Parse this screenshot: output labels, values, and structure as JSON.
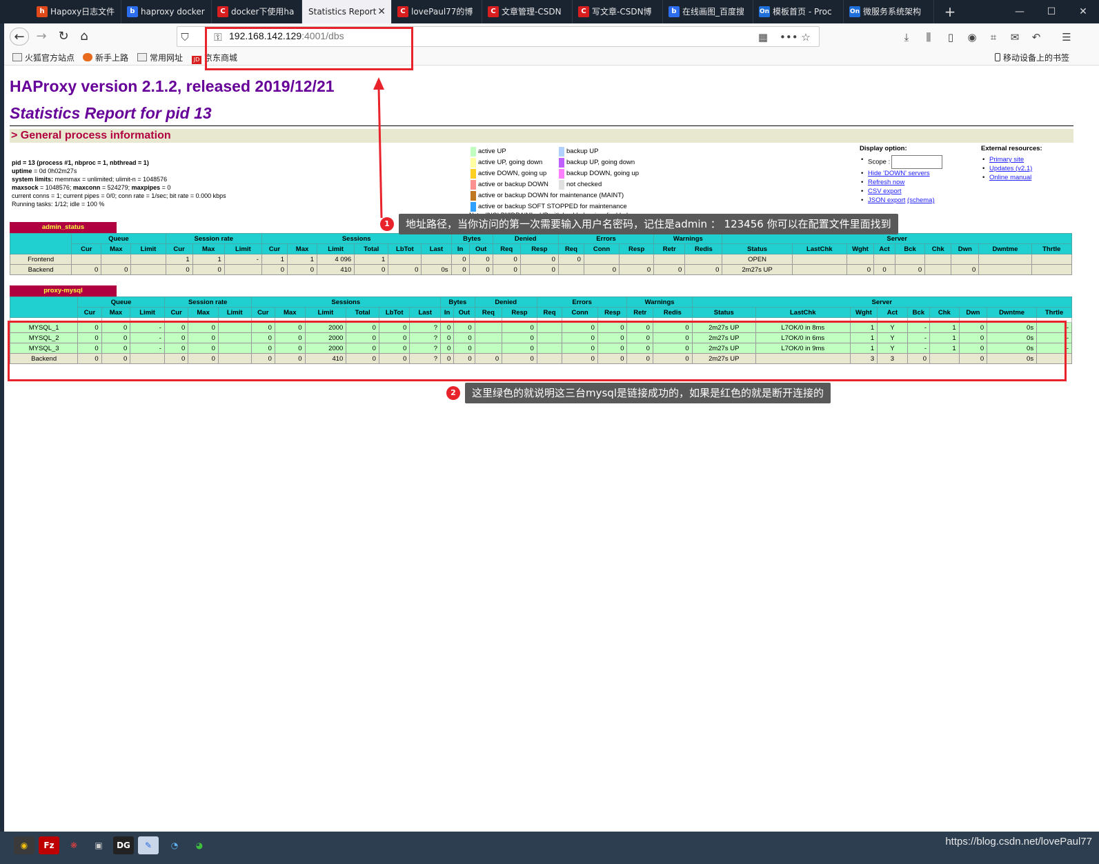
{
  "browser": {
    "tabs": [
      {
        "label": "Hapoxy日志文件",
        "icon": "h"
      },
      {
        "label": "haproxy docker",
        "icon": "b"
      },
      {
        "label": "docker下使用ha",
        "icon": "C"
      },
      {
        "label": "Statistics Report",
        "icon": ""
      },
      {
        "label": "lovePaul77的博",
        "icon": "C"
      },
      {
        "label": "文章管理-CSDN",
        "icon": "C"
      },
      {
        "label": "写文章-CSDN博",
        "icon": "C"
      },
      {
        "label": "在线画图_百度搜",
        "icon": "b"
      },
      {
        "label": "模板首页 - Proc",
        "icon": "On"
      },
      {
        "label": "微服务系统架构",
        "icon": "On"
      }
    ],
    "url_host": "192.168.142.129",
    "url_path": ":4001/dbs",
    "bookmarks": [
      "火狐官方站点",
      "新手上路",
      "常用网址",
      "京东商城"
    ],
    "mobile_bookmarks": "移动设备上的书签"
  },
  "page": {
    "h1": "HAProxy version 2.1.2, released 2019/12/21",
    "h2": "Statistics Report for pid 13",
    "section": "> General process information",
    "proc": {
      "l1": "pid = 13 (process #1, nbproc = 1, nbthread = 1)",
      "l2b": "uptime",
      "l2": " = 0d 0h02m27s",
      "l3b": "system limits:",
      "l3": " memmax = unlimited; ulimit-n = 1048576",
      "l4b": "maxsock",
      "l4": " = 1048576; ",
      "l4b2": "maxconn",
      "l4c": " = 524279; ",
      "l4b3": "maxpipes",
      "l4d": " = 0",
      "l5": "current conns = 1; current pipes = 0/0; conn rate = 1/sec; bit rate = 0.000 kbps",
      "l6": "Running tasks: 1/12; idle = 100 %"
    },
    "legend": {
      "left": [
        "active UP",
        "active UP, going down",
        "active DOWN, going up",
        "active or backup DOWN",
        "active or backup DOWN for maintenance (MAINT)",
        "active or backup SOFT STOPPED for maintenance"
      ],
      "right": [
        "backup UP",
        "backup UP, going down",
        "backup DOWN, going up",
        "not checked"
      ],
      "note": "Note: \"NOLB\"/\"DRAIN\" = UP with load-balancing disabled.",
      "colors_left": [
        "#c0ffc0",
        "#ffffa0",
        "#ffd020",
        "#ff9090",
        "#c07820",
        "#30a0ff"
      ],
      "colors_right": [
        "#b0d0ff",
        "#c060ff",
        "#ff80ff",
        "#e0e0e0"
      ]
    },
    "display": {
      "title": "Display option:",
      "scope": "Scope :",
      "links": [
        "Hide 'DOWN' servers",
        "Refresh now",
        "CSV export",
        "JSON export"
      ],
      "schema": "(schema)"
    },
    "external": {
      "title": "External resources:",
      "links": [
        "Primary site",
        "Updates (v2.1)",
        "Online manual"
      ]
    }
  },
  "tables": {
    "admin": {
      "name": "admin_status",
      "groups": [
        "Queue",
        "Session rate",
        "Sessions",
        "Bytes",
        "Denied",
        "Errors",
        "Warnings",
        "Server"
      ],
      "cols": [
        "Cur",
        "Max",
        "Limit",
        "Cur",
        "Max",
        "Limit",
        "Cur",
        "Max",
        "Limit",
        "Total",
        "LbTot",
        "Last",
        "In",
        "Out",
        "Req",
        "Resp",
        "Req",
        "Conn",
        "Resp",
        "Retr",
        "Redis",
        "Status",
        "LastChk",
        "Wght",
        "Act",
        "Bck",
        "Chk",
        "Dwn",
        "Dwntme",
        "Thrtle"
      ],
      "rows": [
        {
          "cls": "fe",
          "cells": [
            "Frontend",
            "",
            "",
            "",
            "1",
            "1",
            "-",
            "1",
            "1",
            "4 096",
            "1",
            "",
            "",
            "0",
            "0",
            "0",
            "0",
            "0",
            "",
            "",
            "",
            "",
            "OPEN",
            "",
            "",
            "",
            "",
            "",
            "",
            "",
            ""
          ]
        },
        {
          "cls": "be",
          "cells": [
            "Backend",
            "0",
            "0",
            "",
            "0",
            "0",
            "",
            "0",
            "0",
            "410",
            "0",
            "0",
            "0s",
            "0",
            "0",
            "0",
            "0",
            "",
            "0",
            "0",
            "0",
            "0",
            "2m27s UP",
            "",
            "0",
            "0",
            "0",
            "",
            "0",
            "",
            ""
          ]
        }
      ]
    },
    "mysql": {
      "name": "proxy-mysql",
      "groups": [
        "Queue",
        "Session rate",
        "Sessions",
        "Bytes",
        "Denied",
        "Errors",
        "Warnings",
        "Server"
      ],
      "cols": [
        "Cur",
        "Max",
        "Limit",
        "Cur",
        "Max",
        "Limit",
        "Cur",
        "Max",
        "Limit",
        "Total",
        "LbTot",
        "Last",
        "In",
        "Out",
        "Req",
        "Resp",
        "Req",
        "Conn",
        "Resp",
        "Retr",
        "Redis",
        "Status",
        "LastChk",
        "Wght",
        "Act",
        "Bck",
        "Chk",
        "Dwn",
        "Dwntme",
        "Thrtle"
      ],
      "rows": [
        {
          "cls": "up",
          "cells": [
            "MYSQL_1",
            "0",
            "0",
            "-",
            "0",
            "0",
            "",
            "0",
            "0",
            "2000",
            "0",
            "0",
            "?",
            "0",
            "0",
            "",
            "0",
            "",
            "0",
            "0",
            "0",
            "0",
            "2m27s UP",
            "L7OK/0 in 8ms",
            "1",
            "Y",
            "-",
            "1",
            "0",
            "0s",
            "-"
          ]
        },
        {
          "cls": "up",
          "cells": [
            "MYSQL_2",
            "0",
            "0",
            "-",
            "0",
            "0",
            "",
            "0",
            "0",
            "2000",
            "0",
            "0",
            "?",
            "0",
            "0",
            "",
            "0",
            "",
            "0",
            "0",
            "0",
            "0",
            "2m27s UP",
            "L7OK/0 in 6ms",
            "1",
            "Y",
            "-",
            "1",
            "0",
            "0s",
            "-"
          ]
        },
        {
          "cls": "up",
          "cells": [
            "MYSQL_3",
            "0",
            "0",
            "-",
            "0",
            "0",
            "",
            "0",
            "0",
            "2000",
            "0",
            "0",
            "?",
            "0",
            "0",
            "",
            "0",
            "",
            "0",
            "0",
            "0",
            "0",
            "2m27s UP",
            "L7OK/0 in 9ms",
            "1",
            "Y",
            "-",
            "1",
            "0",
            "0s",
            "-"
          ]
        },
        {
          "cls": "be",
          "cells": [
            "Backend",
            "0",
            "0",
            "",
            "0",
            "0",
            "",
            "0",
            "0",
            "410",
            "0",
            "0",
            "?",
            "0",
            "0",
            "0",
            "0",
            "",
            "0",
            "0",
            "0",
            "0",
            "2m27s UP",
            "",
            "3",
            "3",
            "0",
            "",
            "0",
            "0s",
            ""
          ]
        }
      ]
    }
  },
  "annotations": {
    "a1_num": "1",
    "a1_text": "地址路径，当你访问的第一次需要输入用户名密码，记住是admin ： 123456   你可以在配置文件里面找到",
    "a2_num": "2",
    "a2_text": "这里绿色的就说明这三台mysql是链接成功的，如果是红色的就是断开连接的",
    "color": "#e8232b"
  },
  "watermark": "https://blog.csdn.net/lovePaul77"
}
